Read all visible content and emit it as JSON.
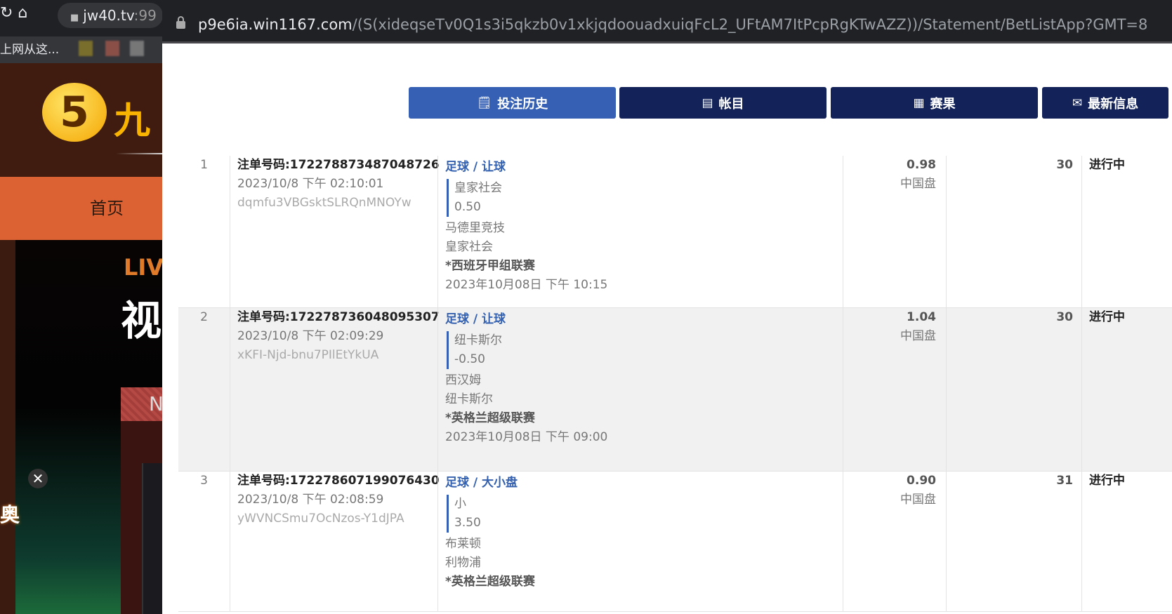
{
  "background_page": {
    "url_host": "jw40.tv",
    "url_rest": ":99",
    "bookmark": "上网从这...",
    "logo_char": "5",
    "logo_text": "九",
    "nav_home": "首页",
    "live": "LIV",
    "video": "视",
    "badge": "N",
    "promo": "奥"
  },
  "popup": {
    "url_host": "p9e6ia.win1167.com",
    "url_path": "/(S(xideqseTv0Q1s3i5qkzb0v1xkjqdoouadxuiqFcL2_UFtAM7ItPcpRgKTwAZZ))/Statement/BetListApp?GMT=8",
    "tabs": [
      {
        "label": "投注历史",
        "icon": "clipboard-icon",
        "active": true
      },
      {
        "label": "帐目",
        "icon": "ledger-icon"
      },
      {
        "label": "赛果",
        "icon": "results-icon"
      },
      {
        "label": "最新信息",
        "icon": "mail-icon"
      }
    ],
    "accent": "#3560b4",
    "tab_color": "#13235a",
    "bets": [
      {
        "index": "1",
        "ticket": "注单号码:172278873487048726",
        "time": "2023/10/8 下午 02:10:01",
        "ref": "dqmfu3VBGsktSLRQnMNOYw",
        "type": "足球 / 让球",
        "selection": "皇家社会",
        "handicap": "0.50",
        "home": "马德里竞技",
        "away": "皇家社会",
        "league": "*西班牙甲组联赛",
        "match_time": "2023年10月08日 下午 10:15",
        "odds": "0.98",
        "odds_type": "中国盘",
        "stake": "30",
        "status": "进行中"
      },
      {
        "index": "2",
        "ticket": "注单号码:172278736048095307",
        "time": "2023/10/8 下午 02:09:29",
        "ref": "xKFI-Njd-bnu7PIlEtYkUA",
        "type": "足球 / 让球",
        "selection": "纽卡斯尔",
        "handicap": "-0.50",
        "home": "西汉姆",
        "away": "纽卡斯尔",
        "league": "*英格兰超级联赛",
        "match_time": "2023年10月08日 下午 09:00",
        "odds": "1.04",
        "odds_type": "中国盘",
        "stake": "30",
        "status": "进行中"
      },
      {
        "index": "3",
        "ticket": "注单号码:172278607199076430",
        "time": "2023/10/8 下午 02:08:59",
        "ref": "yWVNCSmu7OcNzos-Y1dJPA",
        "type": "足球 / 大小盘",
        "selection": "小",
        "handicap": "3.50",
        "home": "布莱顿",
        "away": "利物浦",
        "league": "*英格兰超级联赛",
        "match_time": "",
        "odds": "0.90",
        "odds_type": "中国盘",
        "stake": "31",
        "status": "进行中"
      }
    ]
  }
}
